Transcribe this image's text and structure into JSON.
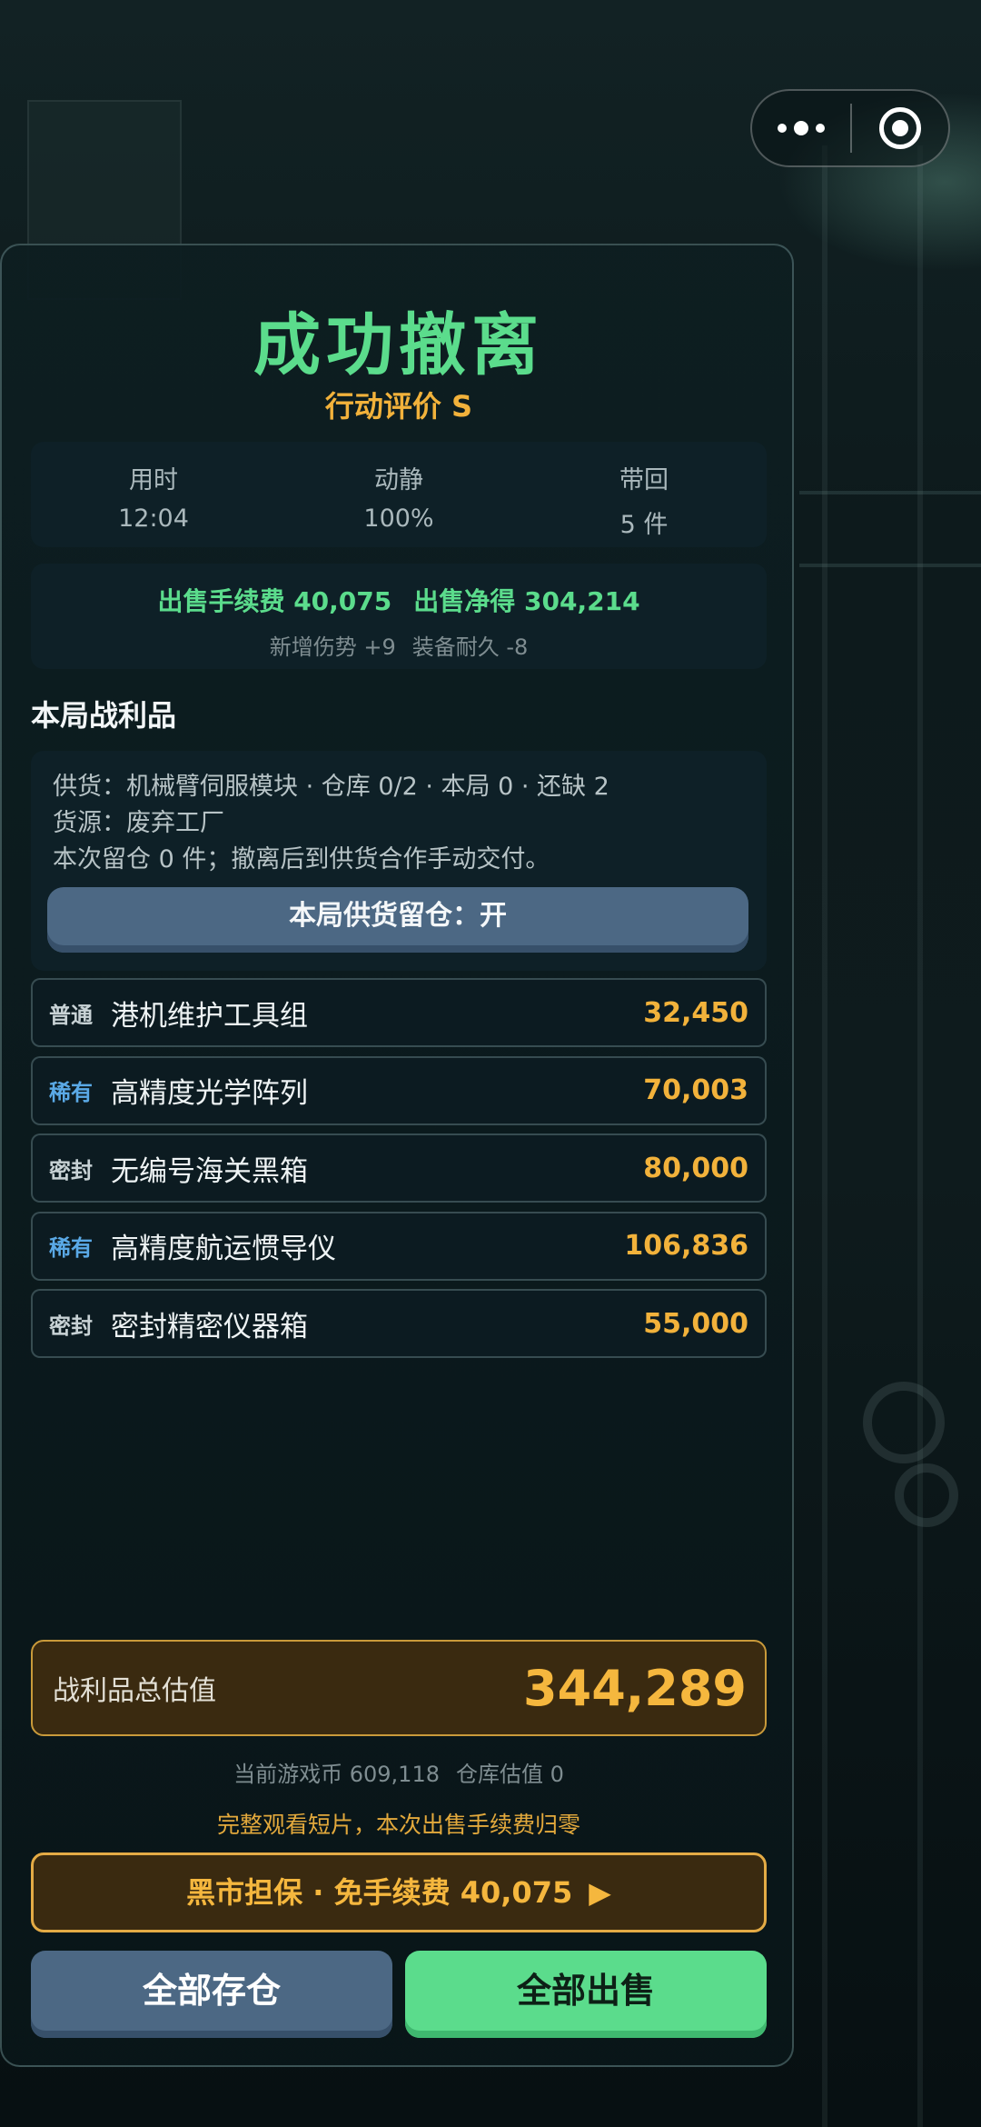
{
  "header": {
    "title": "成功撤离",
    "rating": "行动评价  S"
  },
  "stats": [
    {
      "label": "用时",
      "value": "12:04"
    },
    {
      "label": "动静",
      "value": "100%"
    },
    {
      "label": "带回",
      "value": "5 件"
    }
  ],
  "sale": {
    "fee": "出售手续费 40,075",
    "net": "出售净得 304,214",
    "injury": "新增伤势 +9",
    "durability": "装备耐久 -8"
  },
  "section_title": "本局战利品",
  "supply": {
    "line1": "供货：机械臂伺服模块 · 仓库 0/2 · 本局 0 · 还缺 2",
    "line2": "货源：废弃工厂",
    "line3": "本次留仓 0 件；撤离后到供货合作手动交付。",
    "toggle_label": "本局供货留仓：开"
  },
  "items": [
    {
      "tag": "普通",
      "tag_color": "#c8d2d5",
      "name": "港机维护工具组",
      "value": "32,450"
    },
    {
      "tag": "稀有",
      "tag_color": "#5aa9e6",
      "name": "高精度光学阵列",
      "value": "70,003"
    },
    {
      "tag": "密封",
      "tag_color": "#c8d2d5",
      "name": "无编号海关黑箱",
      "value": "80,000"
    },
    {
      "tag": "稀有",
      "tag_color": "#5aa9e6",
      "name": "高精度航运惯导仪",
      "value": "106,836"
    },
    {
      "tag": "密封",
      "tag_color": "#c8d2d5",
      "name": "密封精密仪器箱",
      "value": "55,000"
    }
  ],
  "total": {
    "label": "战利品总估值",
    "value": "344,289"
  },
  "wallet": {
    "coins": "当前游戏币 609,118",
    "warehouse": "仓库估值 0"
  },
  "tip": "完整观看短片，本次出售手续费归零",
  "blackmarket_label": "黑市担保 · 免手续费 40,075",
  "blackmarket_arrow": "▶",
  "buttons": {
    "store_all": "全部存仓",
    "sell_all": "全部出售"
  },
  "colors": {
    "success": "#5bdc8c",
    "gold": "#f2b23b",
    "rare": "#5aa9e6",
    "store_button": "#4c6884"
  }
}
